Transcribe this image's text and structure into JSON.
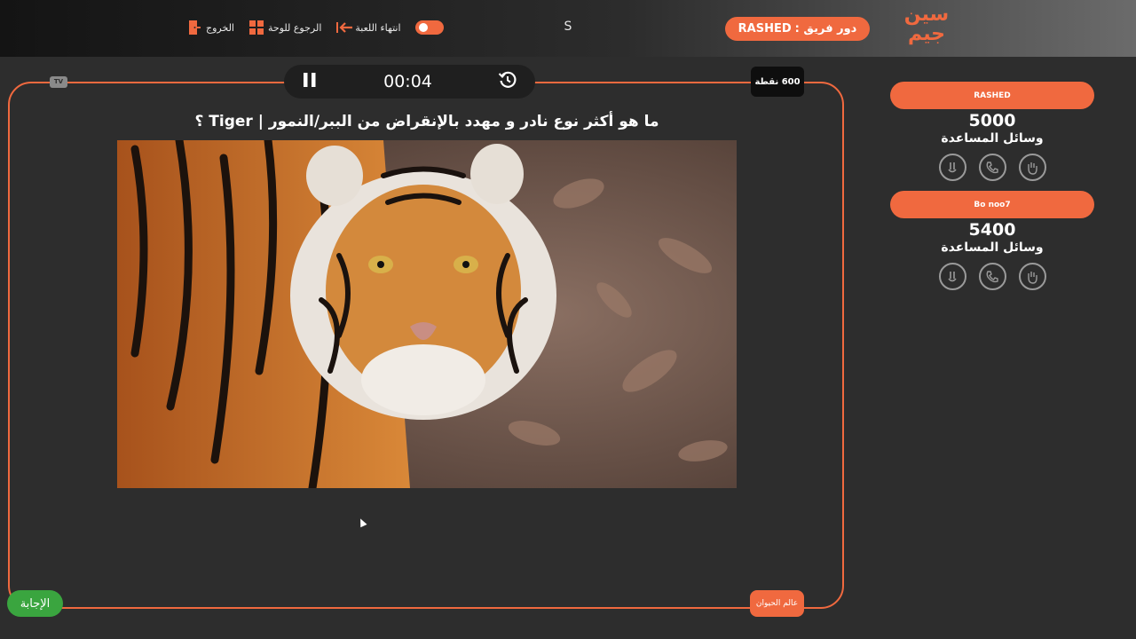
{
  "header": {
    "logo_text": "سين جيم",
    "turn_prefix": "دور فريق :",
    "turn_team": "RASHED",
    "center_letter": "S",
    "menu": {
      "end_game": "انتهاء اللعبة",
      "back_to_board": "الرجوع للوحة",
      "exit": "الخروج"
    }
  },
  "game": {
    "tv_badge": "TV",
    "timer": "00:04",
    "points": "600 نقطة",
    "question": "ما هو أكثر نوع نادر و مهدد بالإنقراض من الببر/النمور | Tiger ؟",
    "category": "عالم الحيوان",
    "answer_button": "الإجابة"
  },
  "teams": [
    {
      "name": "RASHED",
      "score": "5000",
      "aids_label": "وسائل المساعدة"
    },
    {
      "name": "Bo noo7",
      "score": "5400",
      "aids_label": "وسائل المساعدة"
    }
  ],
  "colors": {
    "accent": "#f0693f",
    "answer": "#3aa53f",
    "background": "#2d2d2d"
  }
}
